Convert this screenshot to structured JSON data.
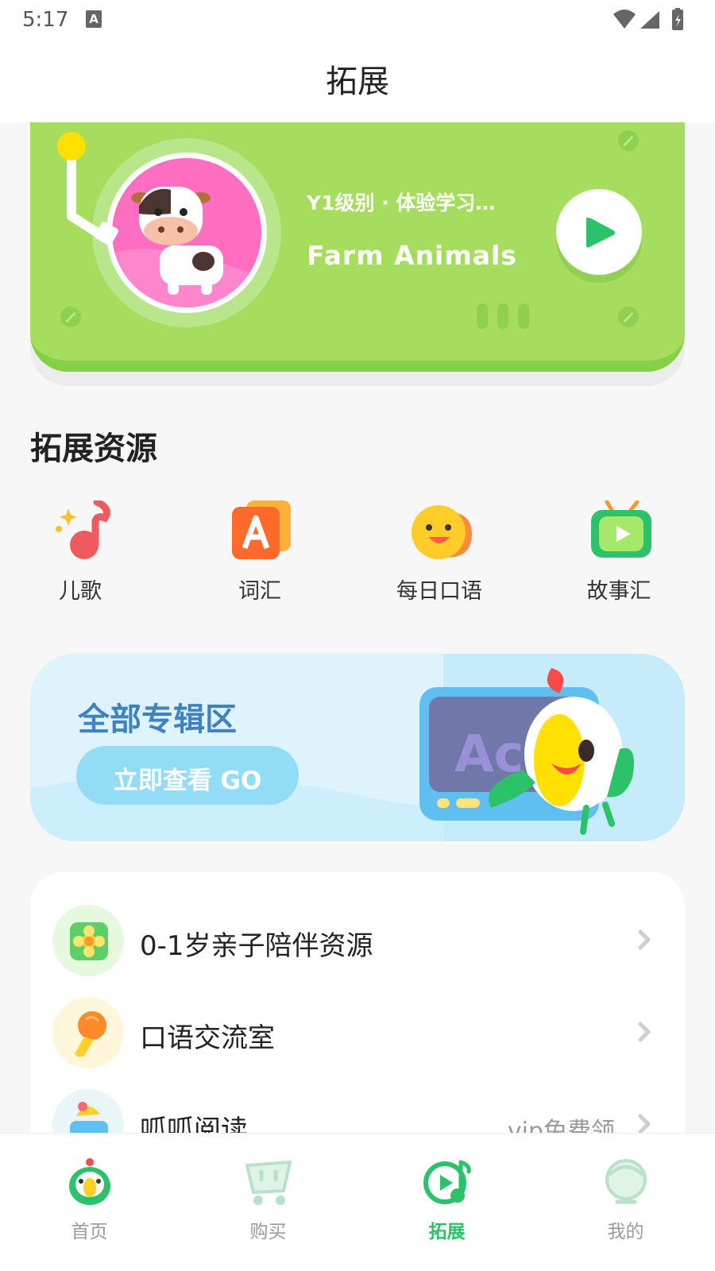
{
  "status_bar": {
    "time": "5:17",
    "notification_badge": "A"
  },
  "header": {
    "title": "拓展"
  },
  "player": {
    "level": "Y1级别 · 体验学习…",
    "track": "Farm Animals",
    "artwork": "cow-illustration",
    "colors": {
      "card": "#a6dd5e",
      "disc": "#ff6ec0",
      "play": "#2cc26a"
    }
  },
  "resources": {
    "title": "拓展资源",
    "items": [
      {
        "label": "儿歌",
        "icon": "music-note-icon"
      },
      {
        "label": "词汇",
        "icon": "letter-a-card-icon"
      },
      {
        "label": "每日口语",
        "icon": "speech-duck-icon"
      },
      {
        "label": "故事汇",
        "icon": "tv-play-icon"
      }
    ]
  },
  "banner": {
    "title": "全部专辑区",
    "button_label": "立即查看 GO",
    "art_text": "Ac"
  },
  "list": [
    {
      "label": "0-1岁亲子陪伴资源",
      "extra": "",
      "icon": "flower-icon"
    },
    {
      "label": "口语交流室",
      "extra": "",
      "icon": "microphone-icon"
    },
    {
      "label": "呱呱阅读",
      "extra": "vip免费领",
      "icon": "reading-icon"
    }
  ],
  "tabs": [
    {
      "label": "首页",
      "icon": "parrot-home-icon",
      "active": false
    },
    {
      "label": "购买",
      "icon": "cart-icon",
      "active": false
    },
    {
      "label": "拓展",
      "icon": "music-play-icon",
      "active": true
    },
    {
      "label": "我的",
      "icon": "profile-face-icon",
      "active": false
    }
  ]
}
